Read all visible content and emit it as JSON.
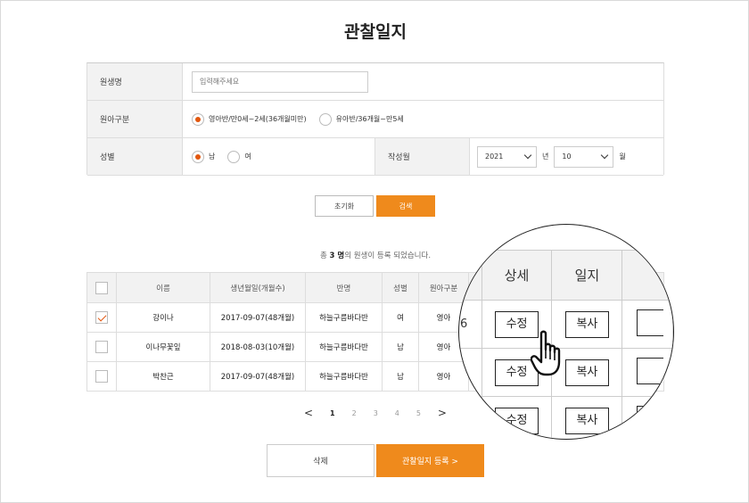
{
  "title": "관찰일지",
  "form": {
    "name_label": "원생명",
    "name_placeholder": "입력해주세요",
    "class_label": "원아구분",
    "class_options": [
      "영아반/만0세~2세(36개월미만)",
      "유아반/36개월~만5세"
    ],
    "gender_label": "성별",
    "gender_options": [
      "남",
      "여"
    ],
    "month_label": "작성월",
    "year_value": "2021",
    "year_unit": "년",
    "month_value": "10",
    "month_unit": "월"
  },
  "buttons": {
    "reset": "초기화",
    "search": "검색",
    "delete": "삭제",
    "register": "관찰일지 등록 >"
  },
  "count": {
    "prefix": "총 ",
    "value": "3 명",
    "suffix": "의 원생이 등록 되었습니다."
  },
  "table": {
    "headers": [
      "이름",
      "생년월일(개월수)",
      "반명",
      "성별",
      "원아구분"
    ],
    "rows": [
      {
        "checked": true,
        "name": "강이나",
        "birth": "2017-09-07(48개월)",
        "class": "하늘구름바다반",
        "gender": "여",
        "type": "영아"
      },
      {
        "checked": false,
        "name": "이나무꽃잎",
        "birth": "2018-08-03(10개월)",
        "class": "하늘구름바다반",
        "gender": "남",
        "type": "영아"
      },
      {
        "checked": false,
        "name": "박찬근",
        "birth": "2017-09-07(48개월)",
        "class": "하늘구름바다반",
        "gender": "남",
        "type": "영아"
      }
    ]
  },
  "pagination": {
    "prev": "<",
    "pages": [
      "1",
      "2",
      "3",
      "4",
      "5"
    ],
    "current": "1",
    "next": ">"
  },
  "magnifier": {
    "headers": [
      "상세",
      "일지"
    ],
    "edge_fragment": "6",
    "edit_label": "수정",
    "copy_label": "복사"
  },
  "colors": {
    "accent": "#ef8a1c",
    "radio_on": "#e2570f"
  }
}
